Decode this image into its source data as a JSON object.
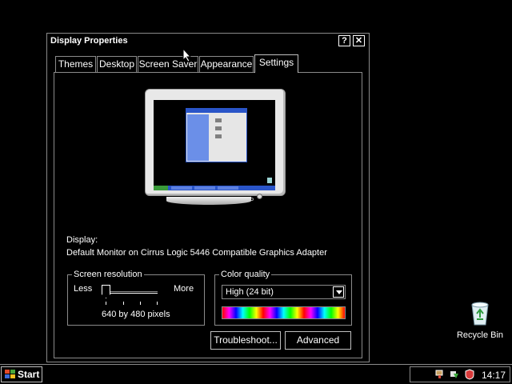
{
  "dialog": {
    "title": "Display Properties",
    "help_button": "?",
    "close_button": "✕",
    "tabs": [
      {
        "label": "Themes"
      },
      {
        "label": "Desktop"
      },
      {
        "label": "Screen Saver"
      },
      {
        "label": "Appearance"
      },
      {
        "label": "Settings",
        "active": true
      }
    ],
    "display_label": "Display:",
    "display_value": "Default Monitor on Cirrus Logic 5446 Compatible Graphics Adapter",
    "screen_resolution": {
      "legend": "Screen resolution",
      "less": "Less",
      "more": "More",
      "value": "640 by 480 pixels",
      "slider_position": 0
    },
    "color_quality": {
      "legend": "Color quality",
      "selected": "High (24 bit)"
    },
    "buttons": {
      "troubleshoot": "Troubleshoot...",
      "advanced": "Advanced"
    }
  },
  "desktop": {
    "recycle_bin_label": "Recycle Bin"
  },
  "taskbar": {
    "start_label": "Start",
    "clock": "14:17",
    "tray_icons": [
      "network-icon",
      "update-icon",
      "security-shield-icon"
    ]
  }
}
